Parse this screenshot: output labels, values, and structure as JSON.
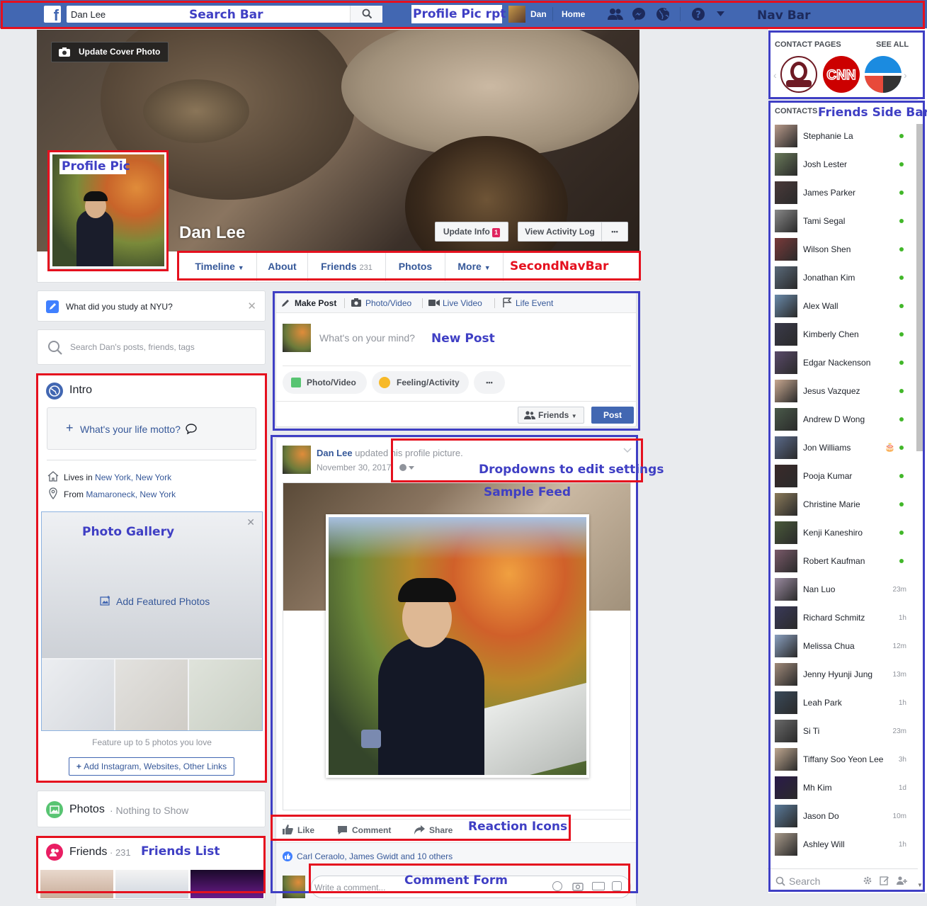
{
  "nav": {
    "search_value": "Dan Lee",
    "user_name": "Dan",
    "home": "Home"
  },
  "cover": {
    "update_cover": "Update Cover Photo",
    "name": "Dan Lee",
    "update_info": "Update Info",
    "update_info_badge": "1",
    "view_activity_log": "View Activity Log",
    "more_dots": "•••"
  },
  "tabs": {
    "timeline": "Timeline",
    "about": "About",
    "friends": "Friends",
    "friends_count": "231",
    "photos": "Photos",
    "more": "More"
  },
  "left": {
    "study_prompt": "What did you study at NYU?",
    "search_placeholder": "Search Dan's posts, friends, tags",
    "intro_title": "Intro",
    "life_motto": "What's your life motto?",
    "lives_in_prefix": "Lives in",
    "lives_in": "New York, New York",
    "from_prefix": "From",
    "from": "Mamaroneck, New York",
    "add_featured": "Add Featured Photos",
    "feature_text": "Feature up to 5 photos you love",
    "add_links": "Add Instagram, Websites, Other Links",
    "photos_title": "Photos",
    "photos_sub": "· Nothing to Show",
    "friends_title": "Friends",
    "friends_count": "· 231"
  },
  "composer": {
    "make_post": "Make Post",
    "photo_video": "Photo/Video",
    "live_video": "Live Video",
    "life_event": "Life Event",
    "placeholder": "What's on your mind?",
    "pill_photo": "Photo/Video",
    "pill_feeling": "Feeling/Activity",
    "pill_more": "•••",
    "audience": "Friends",
    "post": "Post"
  },
  "feed": {
    "author": "Dan Lee",
    "action": "updated his profile picture.",
    "date": "November 30, 2017",
    "like": "Like",
    "comment": "Comment",
    "share": "Share",
    "reactions_text": "Carl Ceraolo, James Gwidt and 10 others",
    "comment_placeholder": "Write a comment..."
  },
  "sidebar": {
    "contact_pages": "CONTACT PAGES",
    "see_all": "SEE ALL",
    "contacts": "CONTACTS",
    "search": "Search",
    "contacts_list": [
      {
        "name": "Stephanie La",
        "status": "online"
      },
      {
        "name": "Josh Lester",
        "status": "online"
      },
      {
        "name": "James Parker",
        "status": "online"
      },
      {
        "name": "Tami Segal",
        "status": "online"
      },
      {
        "name": "Wilson Shen",
        "status": "online"
      },
      {
        "name": "Jonathan Kim",
        "status": "online"
      },
      {
        "name": "Alex Wall",
        "status": "online"
      },
      {
        "name": "Kimberly Chen",
        "status": "online"
      },
      {
        "name": "Edgar Nackenson",
        "status": "online"
      },
      {
        "name": "Jesus Vazquez",
        "status": "online"
      },
      {
        "name": "Andrew D Wong",
        "status": "online"
      },
      {
        "name": "Jon Williams",
        "status": "online"
      },
      {
        "name": "Pooja Kumar",
        "status": "online"
      },
      {
        "name": "Christine Marie",
        "status": "online"
      },
      {
        "name": "Kenji Kaneshiro",
        "status": "online"
      },
      {
        "name": "Robert Kaufman",
        "status": "online"
      },
      {
        "name": "Nan Luo",
        "status": "23m"
      },
      {
        "name": "Richard Schmitz",
        "status": "1h"
      },
      {
        "name": "Melissa Chua",
        "status": "12m"
      },
      {
        "name": "Jenny Hyunji Jung",
        "status": "13m"
      },
      {
        "name": "Leah Park",
        "status": "1h"
      },
      {
        "name": "Si Ti",
        "status": "23m"
      },
      {
        "name": "Tiffany Soo Yeon Lee",
        "status": "3h"
      },
      {
        "name": "Mh Kim",
        "status": "1d"
      },
      {
        "name": "Jason Do",
        "status": "10m"
      },
      {
        "name": "Ashley Will",
        "status": "1h"
      }
    ]
  },
  "annotations": {
    "search_bar": "Search Bar",
    "profile_pic_rpt": "Profile Pic rpt",
    "nav_bar": "Nav Bar",
    "friends_side_bar": "Friends Side Bar",
    "profile_pic": "Profile Pic",
    "second_nav_bar": "SecondNavBar",
    "new_post": "New Post",
    "dropdowns": "Dropdowns to edit settings",
    "sample_feed": "Sample Feed",
    "photo_gallery": "Photo Gallery",
    "reaction_icons": "Reaction Icons",
    "friends_list": "Friends List",
    "comment_form": "Comment Form"
  },
  "colors": {
    "nav_blue": "#4267b2",
    "link_blue": "#365899",
    "annotation_red": "#e5101e",
    "annotation_blue": "#3f3fc4",
    "online_green": "#42b72a"
  }
}
